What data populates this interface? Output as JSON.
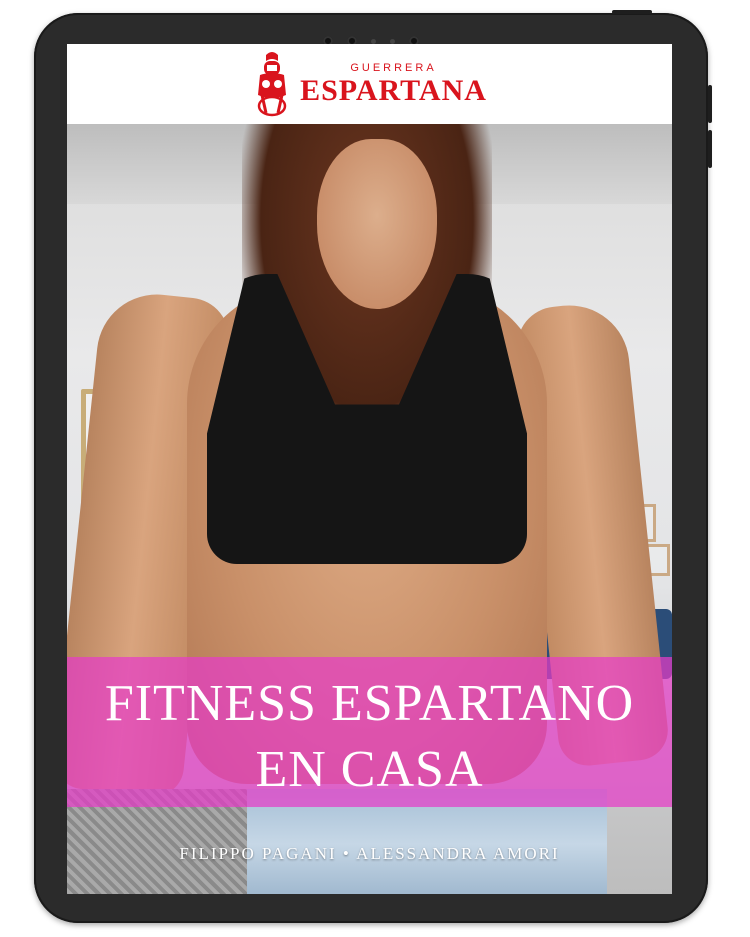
{
  "brand": {
    "logo_top": "GUERRERA",
    "logo_main": "ESPARTANA",
    "logo_icon": "spartan-warrior-icon",
    "color": "#d9141d"
  },
  "cover": {
    "title_line1": "FITNESS ESPARTANO",
    "title_line2": "EN CASA",
    "authors": "FILIPPO PAGANI • ALESSANDRA AMORI",
    "band_color": "#e63cc8"
  }
}
